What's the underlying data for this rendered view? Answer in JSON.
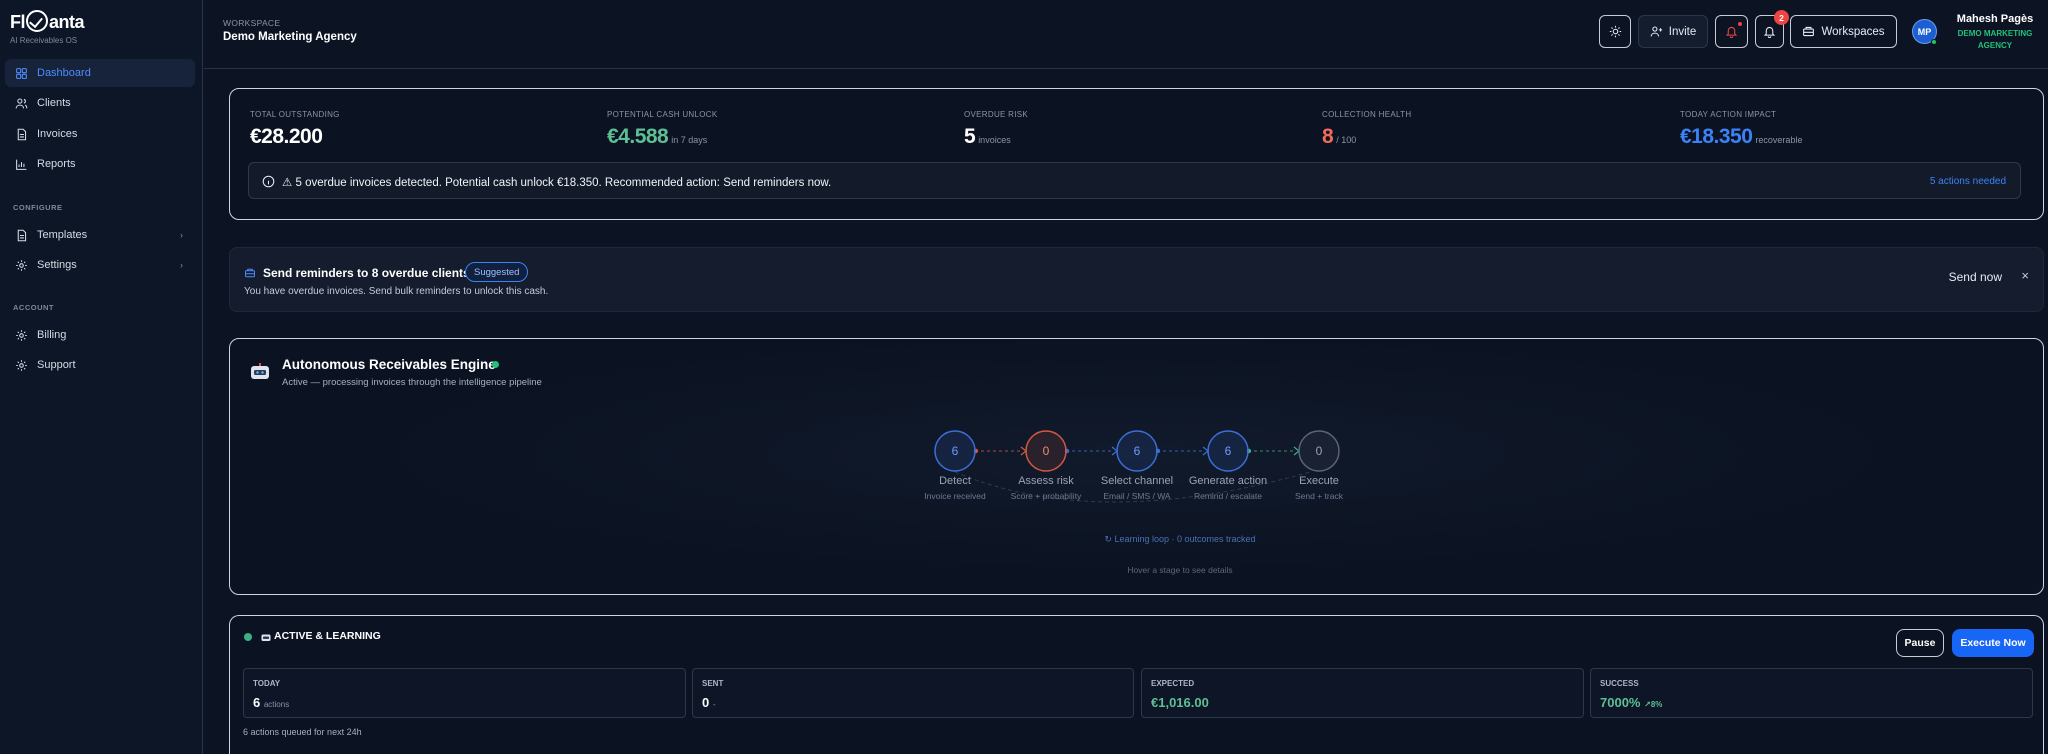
{
  "brand": {
    "logo_prefix": "Fl",
    "logo_suffix": "anta",
    "tagline": "AI Receivables OS"
  },
  "sidebar": {
    "items": [
      {
        "label": "Dashboard",
        "icon": "dashboard-icon",
        "active": true
      },
      {
        "label": "Clients",
        "icon": "users-icon"
      },
      {
        "label": "Invoices",
        "icon": "document-icon"
      },
      {
        "label": "Reports",
        "icon": "bar-chart-icon"
      }
    ],
    "configure_title": "CONFIGURE",
    "configure": [
      {
        "label": "Templates",
        "icon": "document-icon"
      },
      {
        "label": "Settings",
        "icon": "gear-icon"
      }
    ],
    "account_title": "ACCOUNT",
    "account": [
      {
        "label": "Billing",
        "icon": "gear-icon"
      },
      {
        "label": "Support",
        "icon": "gear-icon"
      }
    ]
  },
  "header": {
    "workspace_label": "WORKSPACE",
    "workspace_name": "Demo Marketing Agency",
    "invite_label": "Invite",
    "notification_count": "2",
    "workspaces_label": "Workspaces",
    "avatar_initials": "MP",
    "user_name": "Mahesh Pagès",
    "user_org": "DEMO MARKETING AGENCY"
  },
  "kpis": [
    {
      "label": "TOTAL OUTSTANDING",
      "value": "€28.200",
      "suffix": "",
      "color": "#ffffff"
    },
    {
      "label": "POTENTIAL CASH UNLOCK",
      "value": "€4.588",
      "suffix": "in 7 days",
      "color": "#5fbf94"
    },
    {
      "label": "OVERDUE RISK",
      "value": "5",
      "suffix": "invoices",
      "color": "#ffffff"
    },
    {
      "label": "COLLECTION HEALTH",
      "value": "8",
      "suffix": "/ 100",
      "color": "#f26a5a"
    },
    {
      "label": "TODAY ACTION IMPACT",
      "value": "€18.350",
      "suffix": "recoverable",
      "color": "#3b82f6"
    }
  ],
  "alert": {
    "text": "⚠ 5 overdue invoices detected. Potential cash unlock €18.350. Recommended action: Send reminders now.",
    "link": "5 actions needed"
  },
  "suggestion": {
    "title": "Send reminders to 8 overdue clients",
    "pill": "Suggested",
    "subtitle": "You have overdue invoices. Send bulk reminders to unlock this cash.",
    "action": "Send now",
    "close": "×"
  },
  "engine": {
    "title": "Autonomous Receivables Engine",
    "subtitle": "Active — processing invoices through the intelligence pipeline",
    "stages": [
      {
        "count": "6",
        "label": "Detect",
        "sub": "Invoice received",
        "color": "#3b6fd6"
      },
      {
        "count": "0",
        "label": "Assess risk",
        "sub": "Score + probability",
        "color": "#d4583f"
      },
      {
        "count": "6",
        "label": "Select channel",
        "sub": "Email / SMS / WA",
        "color": "#3b6fd6"
      },
      {
        "count": "6",
        "label": "Generate action",
        "sub": "Remind / escalate",
        "color": "#3b6fd6"
      },
      {
        "count": "0",
        "label": "Execute",
        "sub": "Send + track",
        "color": "#5b6475"
      }
    ],
    "loop_text": "↻ Learning loop · 0 outcomes tracked",
    "hover_hint": "Hover a stage to see details"
  },
  "activity": {
    "title": "ACTIVE & LEARNING",
    "pause_label": "Pause",
    "execute_label": "Execute Now",
    "stats": [
      {
        "label": "TODAY",
        "value": "6",
        "suffix": "actions",
        "color": "#ffffff"
      },
      {
        "label": "SENT",
        "value": "0",
        "suffix": "-",
        "color": "#ffffff"
      },
      {
        "label": "EXPECTED",
        "value": "€1,016.00",
        "suffix": "",
        "color": "#5fbf94"
      },
      {
        "label": "SUCCESS",
        "value": "7000%",
        "suffix": "↗8%",
        "color": "#5fbf94"
      }
    ],
    "queued": "6 actions queued for next 24h"
  }
}
